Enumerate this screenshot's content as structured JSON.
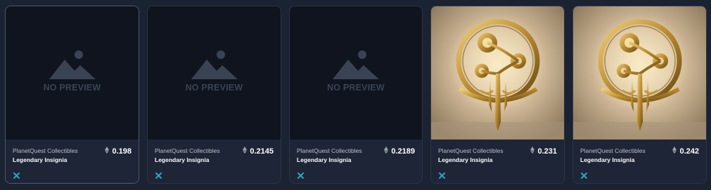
{
  "colors": {
    "background": "#1b2232",
    "card": "#1e2536",
    "placeholder_bg": "#0f141e",
    "placeholder_fg": "#3a4354",
    "chain_icon": "#2aa7c4"
  },
  "cards": [
    {
      "media": "placeholder",
      "placeholder_text": "NO PREVIEW",
      "collection": "PlanetQuest Collectibles",
      "name": "Legendary Insignia",
      "price": "0.198",
      "currency_icon": "ethereum-icon",
      "chain_icon": "x-chain-icon",
      "selected": true
    },
    {
      "media": "placeholder",
      "placeholder_text": "NO PREVIEW",
      "collection": "PlanetQuest Collectibles",
      "name": "Legendary Insignia",
      "price": "0.2145",
      "currency_icon": "ethereum-icon",
      "chain_icon": "x-chain-icon",
      "selected": false
    },
    {
      "media": "placeholder",
      "placeholder_text": "NO PREVIEW",
      "collection": "PlanetQuest Collectibles",
      "name": "Legendary Insignia",
      "price": "0.2189",
      "currency_icon": "ethereum-icon",
      "chain_icon": "x-chain-icon",
      "selected": false
    },
    {
      "media": "image",
      "image_desc": "golden-insignia-art",
      "collection": "PlanetQuest Collectibles",
      "name": "Legendary Insignia",
      "price": "0.231",
      "currency_icon": "ethereum-icon",
      "chain_icon": "x-chain-icon",
      "selected": false
    },
    {
      "media": "image",
      "image_desc": "golden-insignia-art",
      "collection": "PlanetQuest Collectibles",
      "name": "Legendary Insignia",
      "price": "0.242",
      "currency_icon": "ethereum-icon",
      "chain_icon": "x-chain-icon",
      "selected": false
    }
  ]
}
